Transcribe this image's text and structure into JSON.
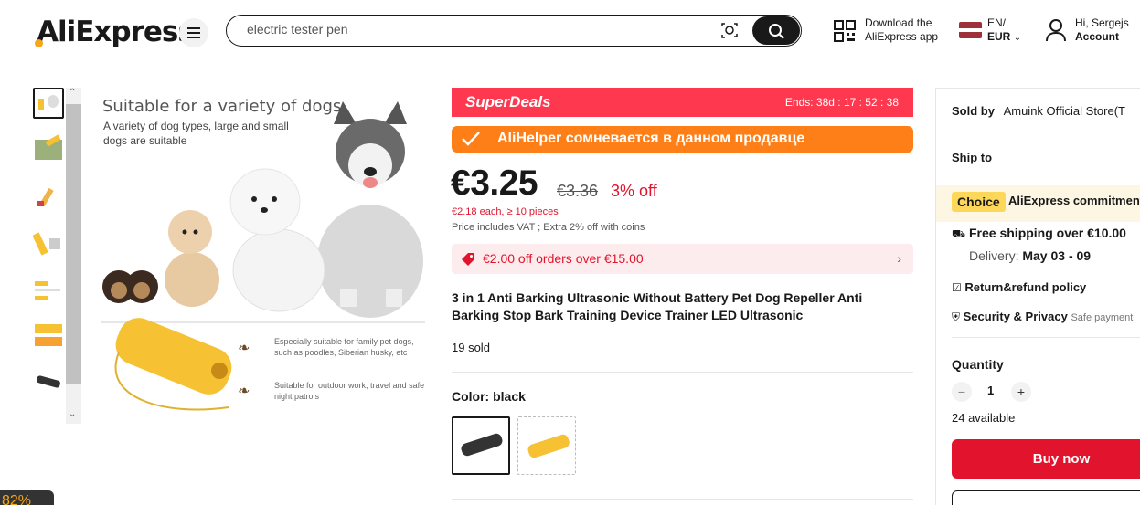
{
  "header": {
    "logo": "AliExpress",
    "search_value": "electric tester pen",
    "download_line1": "Download the",
    "download_line2": "AliExpress app",
    "lang_line1": "EN/",
    "lang_line2": "EUR",
    "account_line1": "Hi, Sergejs",
    "account_line2": "Account"
  },
  "gallery": {
    "title": "Suitable for a variety of dogs",
    "subtitle": "A variety of dog types, large and small dogs are suitable",
    "note1": "Especially suitable for family pet dogs, such as poodles, Siberian husky, etc",
    "note2": "Suitable for outdoor work, travel and safe night patrols"
  },
  "superdeals": {
    "title": "SuperDeals",
    "ends": "Ends: 38d : 17 : 52 : 38"
  },
  "alihelper": {
    "text": "AliHelper сомневается в данном продавце"
  },
  "pricing": {
    "price": "€3.25",
    "old_price": "€3.36",
    "discount": "3% off",
    "each": "€2.18 each, ≥ 10 pieces",
    "vat": "Price includes VAT ; Extra 2% off with coins"
  },
  "coupon": {
    "text": "€2.00 off orders over €15.00"
  },
  "product": {
    "title": "3 in 1 Anti Barking Ultrasonic Without Battery Pet Dog Repeller Anti Barking Stop Bark Training Device Trainer LED Ultrasonic",
    "sold": "19 sold",
    "color_label": "Color: black"
  },
  "sidebar": {
    "sold_by_label": "Sold by",
    "store": "Amuink Official Store(T",
    "ship_to": "Ship to",
    "choice": "Choice",
    "choice_text": "AliExpress commitment",
    "free_shipping": "Free shipping over €10.00",
    "delivery_label": "Delivery:",
    "delivery_date": "May 03 - 09",
    "return": "Return&refund policy",
    "security": "Security & Privacy",
    "security_sub": "Safe payment",
    "quantity_label": "Quantity",
    "quantity": "1",
    "available": "24 available",
    "buy_now": "Buy now"
  },
  "zoom": "82%",
  "colors": {
    "brand_red": "#e2132c",
    "superdeals": "#fd384f",
    "alihelper": "#fe7f17",
    "choice": "#fdd75a"
  }
}
